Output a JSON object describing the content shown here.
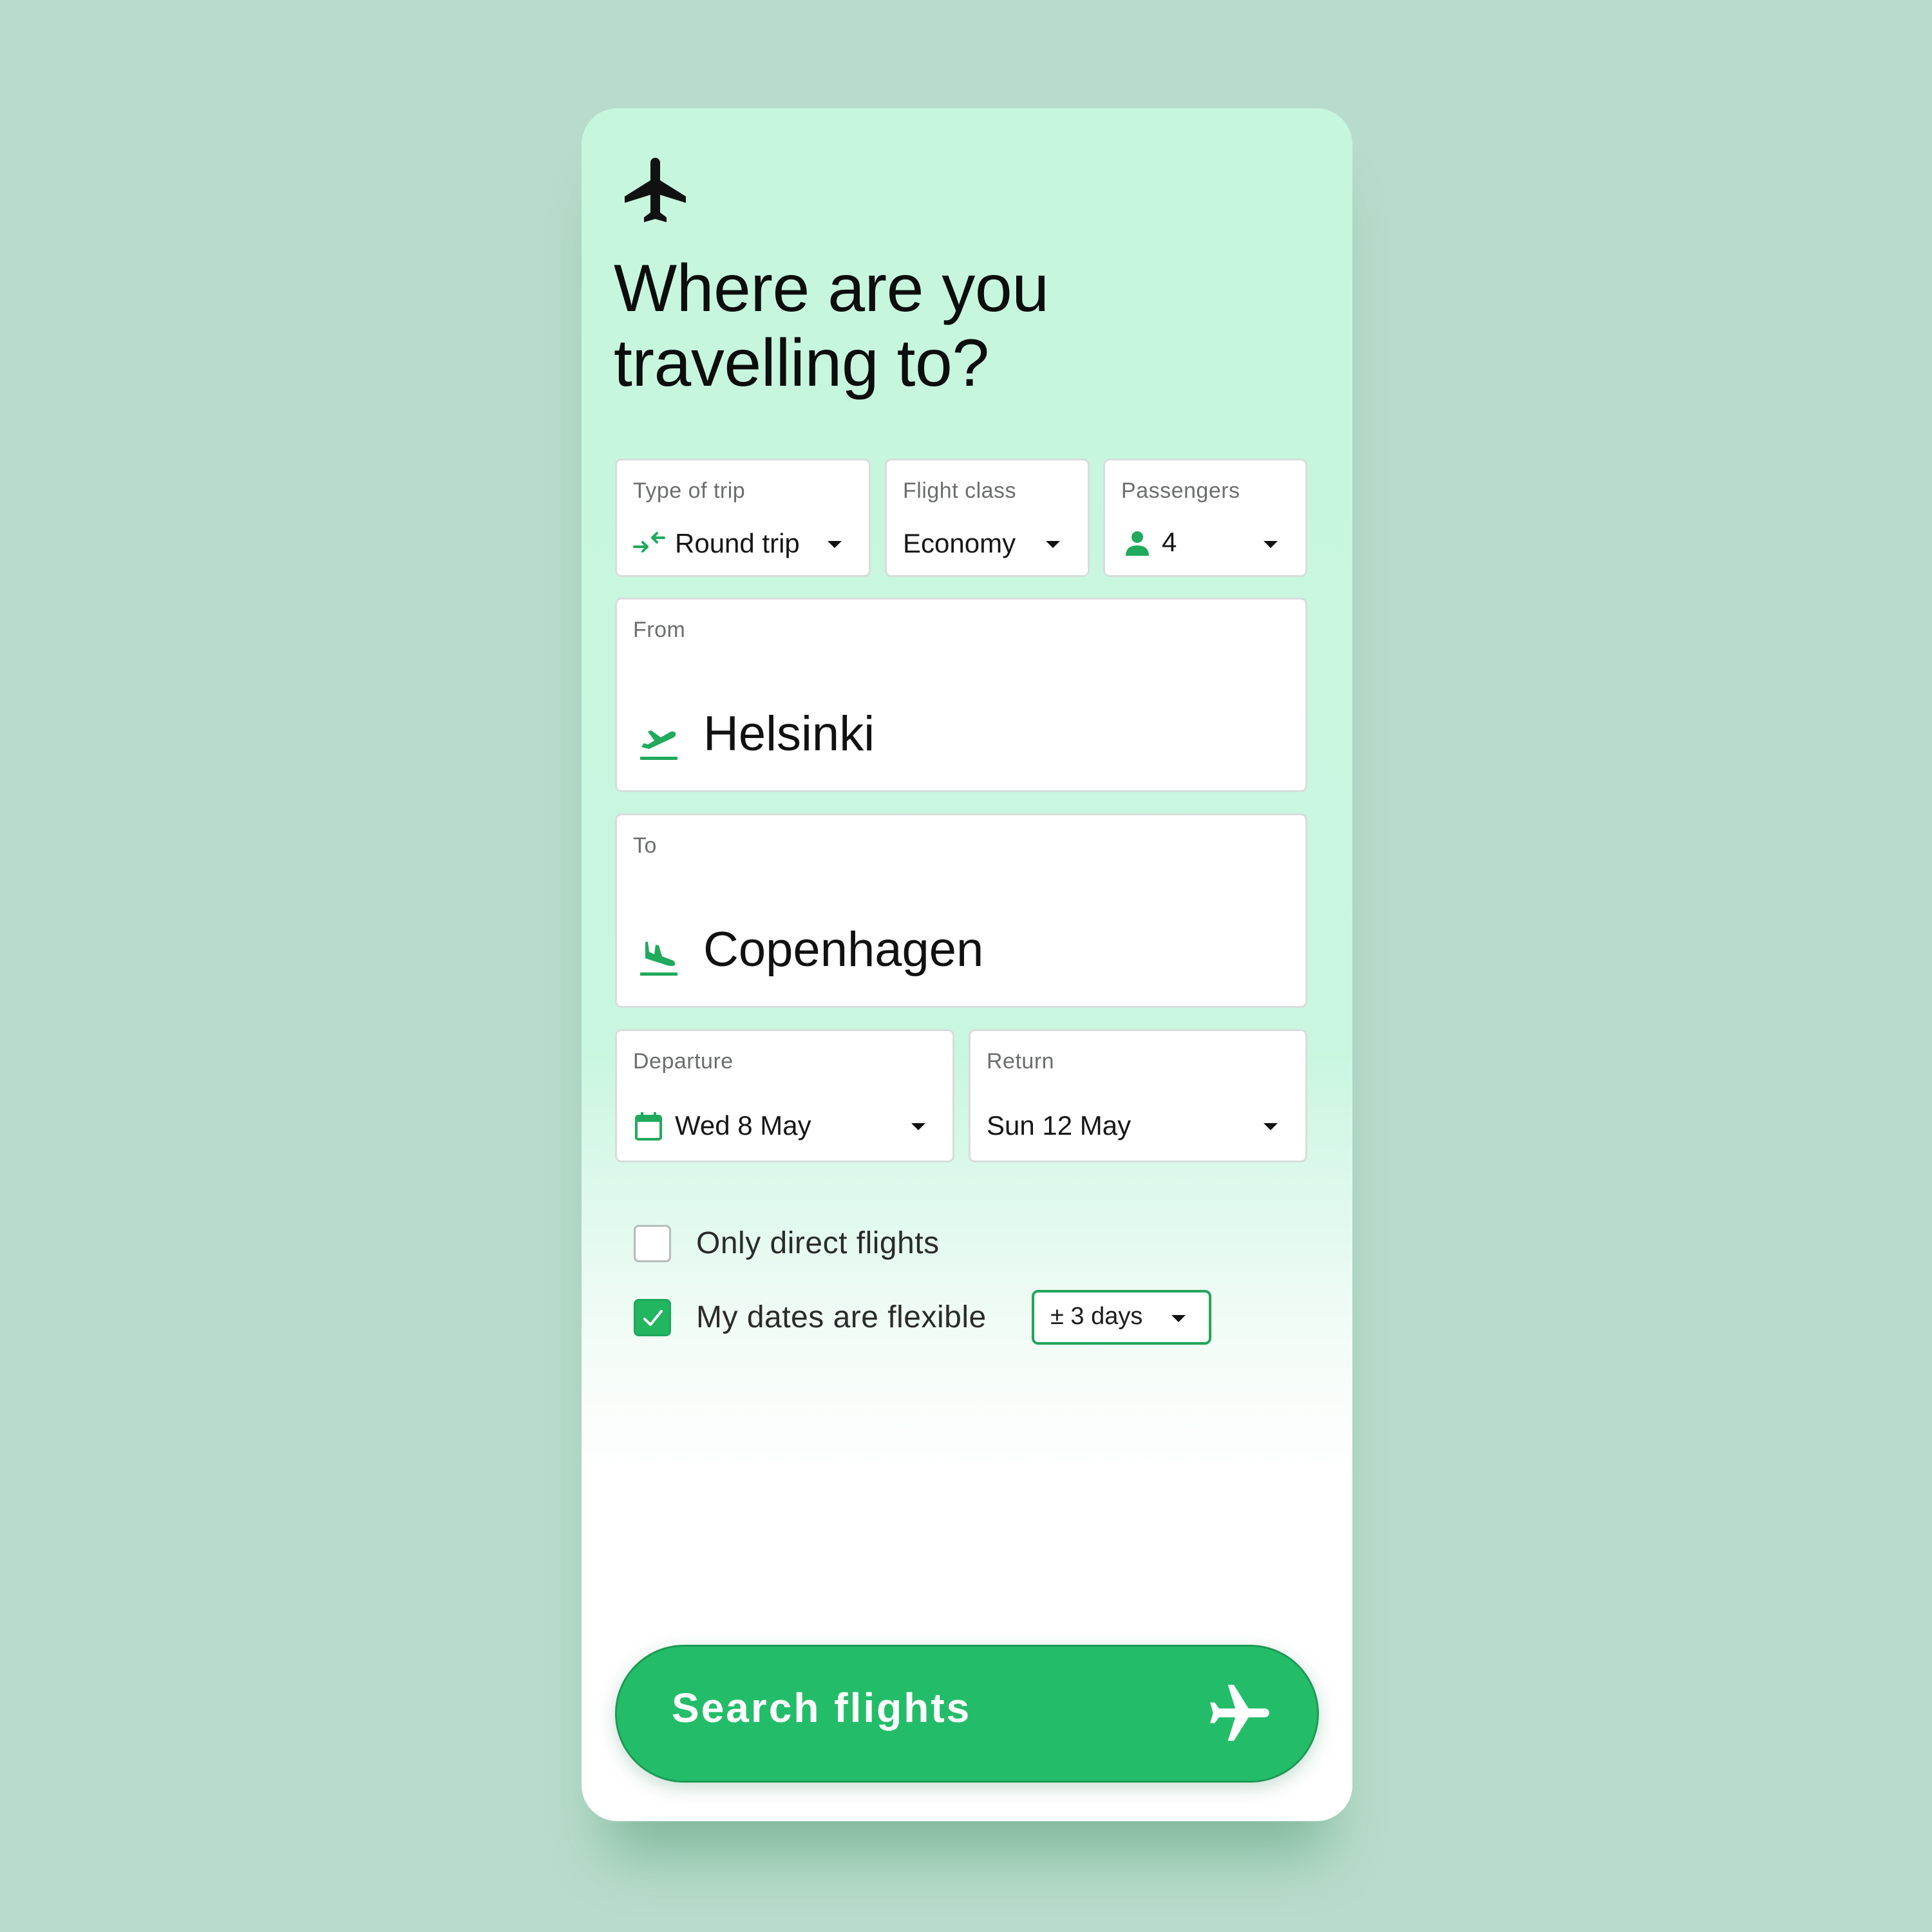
{
  "header": {
    "icon": "airplane-icon",
    "title_line1": "Where are you",
    "title_line2": "travelling to?"
  },
  "trip_type": {
    "label": "Type of trip",
    "value": "Round trip",
    "icon": "round-trip-arrows-icon"
  },
  "flight_class": {
    "label": "Flight class",
    "value": "Economy"
  },
  "passengers": {
    "label": "Passengers",
    "value": "4",
    "icon": "person-icon"
  },
  "from": {
    "label": "From",
    "value": "Helsinki",
    "icon": "takeoff-icon"
  },
  "to": {
    "label": "To",
    "value": "Copenhagen",
    "icon": "landing-icon"
  },
  "departure": {
    "label": "Departure",
    "value": "Wed 8 May",
    "icon": "calendar-icon"
  },
  "return": {
    "label": "Return",
    "value": "Sun 12 May"
  },
  "options": {
    "direct_flights": {
      "label": "Only direct flights",
      "checked": false
    },
    "flexible_dates": {
      "label": "My dates are flexible",
      "checked": true,
      "range": "± 3 days"
    }
  },
  "search_button": {
    "label": "Search flights",
    "icon": "airplane-icon"
  },
  "colors": {
    "accent": "#23bd69",
    "icon_green": "#1faa5c",
    "background": "#b8dccb",
    "card_top": "#c6f6de"
  }
}
